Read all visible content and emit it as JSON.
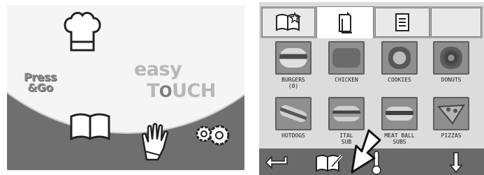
{
  "left_screen": {
    "press_go_line1": "Press",
    "press_go_line2": "&Go",
    "easy": "easy",
    "touch_t": "T",
    "touch_o": "O",
    "touch_rest": "UCH",
    "icons": [
      "chef-hat-icon",
      "book-icon",
      "hand-icon",
      "gears-icon"
    ]
  },
  "right_screen": {
    "tabs": [
      {
        "icon": "book-star-icon",
        "active": false
      },
      {
        "icon": "page-icon",
        "active": true
      },
      {
        "icon": "document-list-icon",
        "active": false
      },
      {
        "icon": "empty",
        "active": false
      }
    ],
    "items": [
      {
        "label": "BURGERS",
        "sublabel": "(0)"
      },
      {
        "label": "CHICKEN",
        "sublabel": ""
      },
      {
        "label": "COOKIES",
        "sublabel": ""
      },
      {
        "label": "DONUTS",
        "sublabel": ""
      },
      {
        "label": "HOTDOGS",
        "sublabel": ""
      },
      {
        "label": "ITAL",
        "sublabel": "SUB"
      },
      {
        "label": "MEAT BALL",
        "sublabel": "SUBS"
      },
      {
        "label": "PIZZAS",
        "sublabel": ""
      }
    ],
    "bottom_icons": [
      "back-arrow-icon",
      "book-pencil-icon",
      "thermometer-icon",
      "down-arrow-icon"
    ]
  },
  "colors": {
    "screen_gray": "#6f6f6f",
    "tab_bar": "#a8a8a8",
    "content_bg": "#dcdcdc"
  }
}
